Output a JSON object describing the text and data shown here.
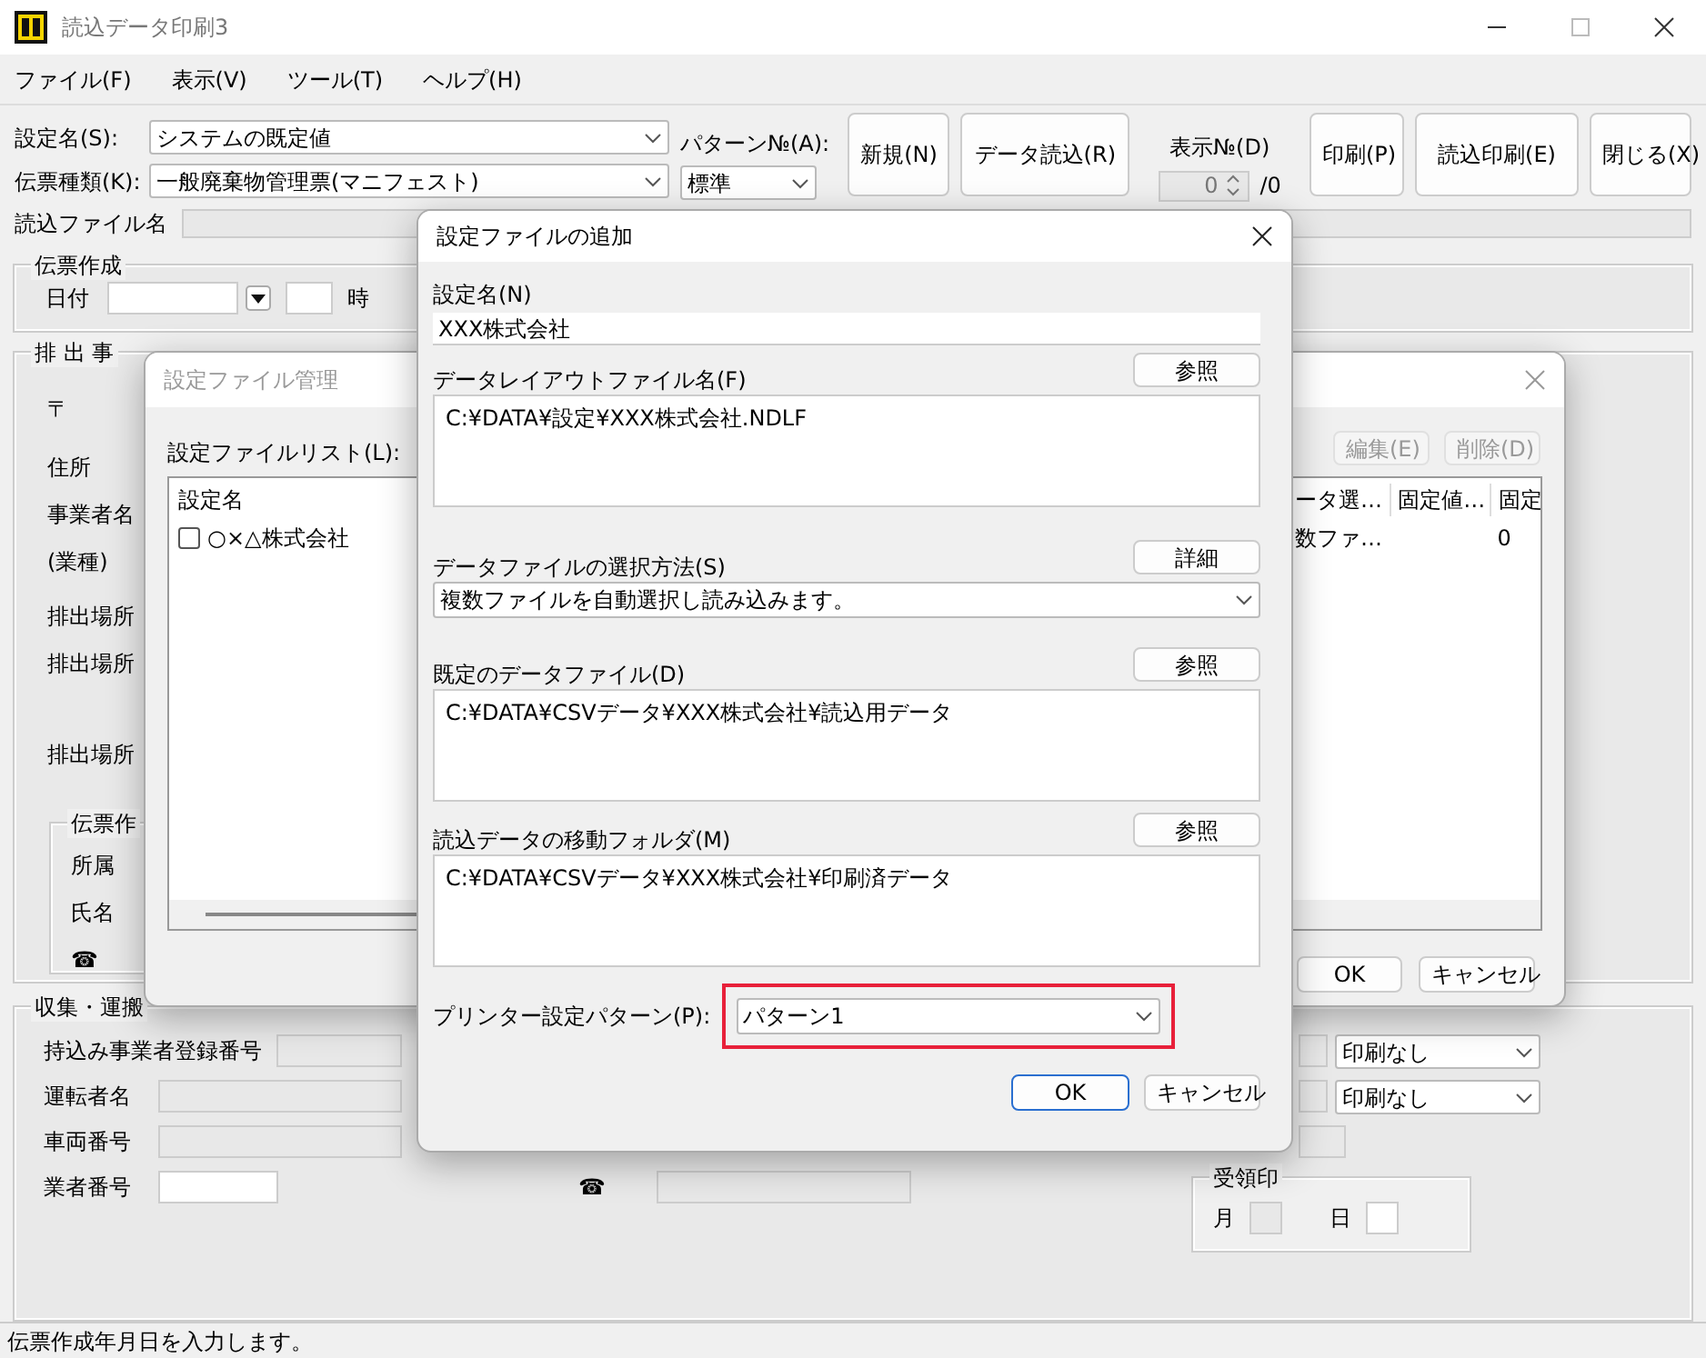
{
  "window": {
    "title": "読込データ印刷3"
  },
  "menu": [
    "ファイル(F)",
    "表示(V)",
    "ツール(T)",
    "ヘルプ(H)"
  ],
  "toolbar": {
    "setting_label": "設定名(S):",
    "setting_value": "システムの既定値",
    "slip_label": "伝票種類(K):",
    "slip_value": "一般廃棄物管理票(マニフェスト)",
    "pattern_label": "パターン№(A):",
    "pattern_value": "標準",
    "buttons": [
      "新規(N)",
      "データ読込(R)"
    ],
    "display_label": "表示№(D)",
    "display_value": "0",
    "display_total": "/0",
    "right_buttons": [
      "印刷(P)",
      "読込印刷(E)",
      "閉じる(X)"
    ]
  },
  "file_row": {
    "label": "読込ファイル名"
  },
  "slip_group": {
    "title": "伝票作成",
    "date_label": "日付",
    "hour_label": "時"
  },
  "emitter_group": {
    "title": "排 出 事",
    "labels": [
      "〒",
      "住所",
      "事業者名",
      "(業種)",
      "排出場所",
      "排出場所",
      "排出場所"
    ],
    "sub_group": {
      "title": "伝票作",
      "labels": [
        "所属",
        "氏名",
        "☎"
      ]
    }
  },
  "collect_group": {
    "title": "収集・運搬",
    "rows": [
      {
        "label": "持込み事業者登録番号",
        "print": "印刷なし"
      },
      {
        "label": "運転者名",
        "print": "印刷なし"
      },
      {
        "label": "車両番号"
      },
      {
        "label": "業者番号",
        "phone": "☎"
      }
    ],
    "receipt": {
      "title": "受領印",
      "month": "月",
      "day": "日"
    }
  },
  "status_bar": "伝票作成年月日を入力します。",
  "manager_dialog": {
    "title": "設定ファイル管理",
    "list_label": "設定ファイルリスト(L):",
    "column": "設定名",
    "items": [
      {
        "name": "○×△株式会社",
        "checked": false
      }
    ],
    "buttons": [
      {
        "label": "編集(E)",
        "disabled": true
      },
      {
        "label": "削除(D)",
        "disabled": true
      }
    ],
    "columns": [
      "ータ選…",
      "固定値…",
      "固定"
    ],
    "rows": [
      {
        "column_1": "数ファ…",
        "column_3": "0"
      }
    ],
    "ok": "OK",
    "cancel": "キャンセル"
  },
  "add_dialog": {
    "title": "設定ファイルの追加",
    "fields": [
      {
        "kind": "text",
        "label": "設定名(N)",
        "value": "XXX株式会社"
      },
      {
        "kind": "area",
        "label": "データレイアウトファイル名(F)",
        "button": "参照",
        "value": "C:¥DATA¥設定¥XXX株式会社.NDLF"
      },
      {
        "kind": "select",
        "label": "データファイルの選択方法(S)",
        "button": "詳細",
        "value": "複数ファイルを自動選択し読み込みます。"
      },
      {
        "kind": "area",
        "label": "既定のデータファイル(D)",
        "button": "参照",
        "value": "C:¥DATA¥CSVデータ¥XXX株式会社¥読込用データ"
      },
      {
        "kind": "area",
        "label": "読込データの移動フォルダ(M)",
        "button": "参照",
        "value": "C:¥DATA¥CSVデータ¥XXX株式会社¥印刷済データ"
      }
    ],
    "printer": {
      "label": "プリンター設定パターン(P):",
      "value": "パターン1",
      "highlighted": true
    },
    "ok": "OK",
    "cancel": "キャンセル"
  }
}
